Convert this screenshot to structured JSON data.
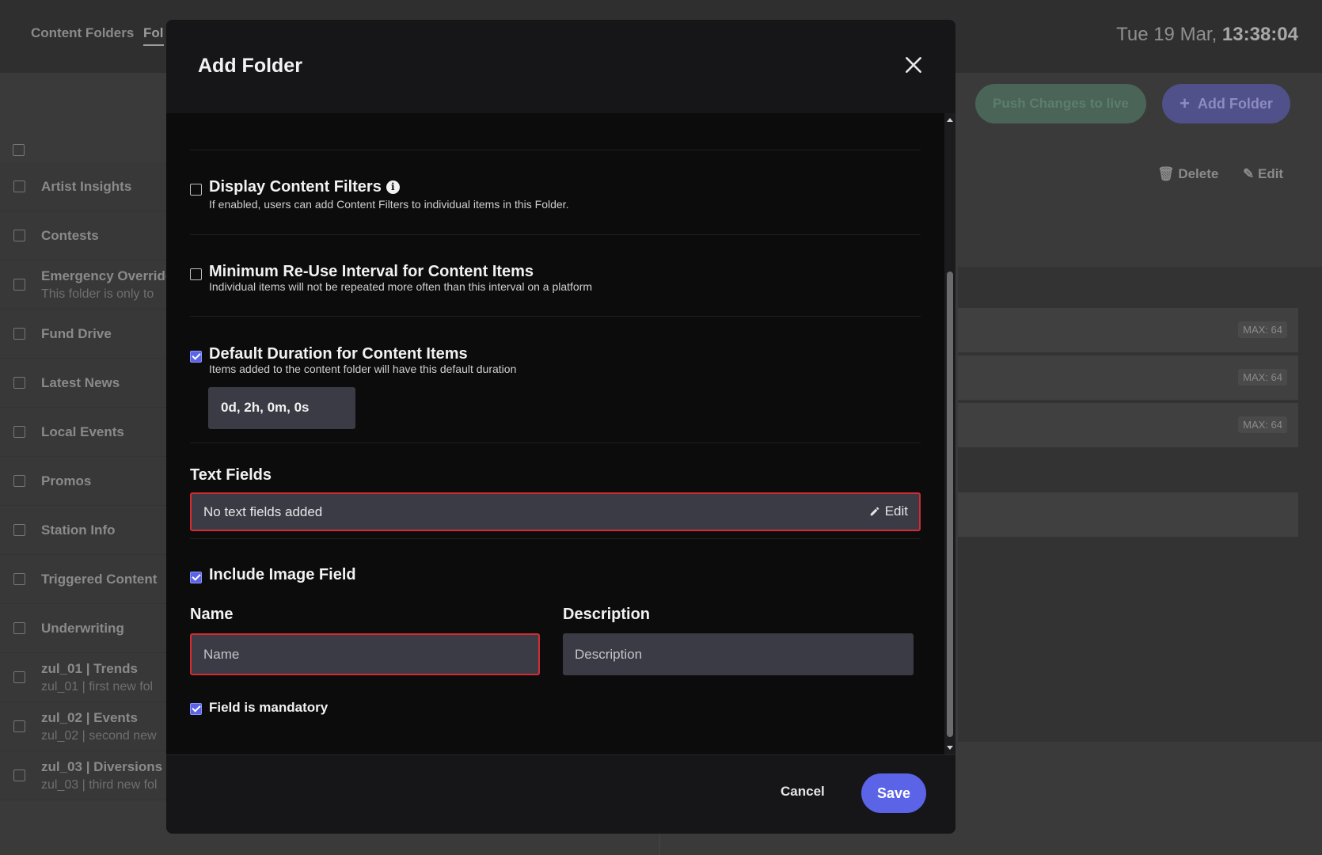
{
  "background": {
    "nav_tabs": [
      "Content Folders",
      "Fol"
    ],
    "clock": {
      "date": "Tue 19 Mar,",
      "time": "13:38:04"
    },
    "push_button": "Push Changes to live",
    "add_folder_button": "Add Folder",
    "actions": {
      "delete": "Delete",
      "edit": "Edit"
    },
    "folders": [
      {
        "title": "Artist Insights",
        "subtitle": ""
      },
      {
        "title": "Contests",
        "subtitle": ""
      },
      {
        "title": "Emergency Override",
        "subtitle": "This folder is only to"
      },
      {
        "title": "Fund Drive",
        "subtitle": ""
      },
      {
        "title": "Latest News",
        "subtitle": ""
      },
      {
        "title": "Local Events",
        "subtitle": ""
      },
      {
        "title": "Promos",
        "subtitle": ""
      },
      {
        "title": "Station Info",
        "subtitle": ""
      },
      {
        "title": "Triggered Content",
        "subtitle": ""
      },
      {
        "title": "Underwriting",
        "subtitle": ""
      },
      {
        "title": "zul_01 | Trends",
        "subtitle": "zul_01 | first new fol"
      },
      {
        "title": "zul_02 | Events",
        "subtitle": "zul_02 | second new"
      },
      {
        "title": "zul_03 | Diversions",
        "subtitle": "zul_03 | third new fol"
      }
    ],
    "max_badges": [
      "MAX: 64",
      "MAX: 64",
      "MAX: 64"
    ]
  },
  "modal": {
    "title": "Add Folder",
    "options": {
      "content_filters": {
        "title": "Display Content Filters",
        "desc": "If enabled, users can add Content Filters to individual items in this Folder.",
        "checked": false
      },
      "reuse_interval": {
        "title": "Minimum Re-Use Interval for Content Items",
        "desc": "Individual items will not be repeated more often than this interval on a platform",
        "checked": false
      },
      "default_duration": {
        "title": "Default Duration for Content Items",
        "desc": "Items added to the content folder will have this default duration",
        "checked": true,
        "value": "0d, 2h, 0m, 0s"
      }
    },
    "text_fields": {
      "label": "Text Fields",
      "empty_message": "No text fields added",
      "edit_label": "Edit"
    },
    "image_field": {
      "label": "Include Image Field",
      "checked": true,
      "name_label": "Name",
      "name_placeholder": "Name",
      "name_value": "",
      "description_label": "Description",
      "description_placeholder": "Description",
      "description_value": "",
      "mandatory_label": "Field is mandatory",
      "mandatory_checked": true
    },
    "footer": {
      "cancel": "Cancel",
      "save": "Save"
    }
  },
  "colors": {
    "accent": "#5b64e6",
    "error": "#d42b33",
    "field_bg": "#3b3b45",
    "modal_bg": "#0c0c0d"
  }
}
